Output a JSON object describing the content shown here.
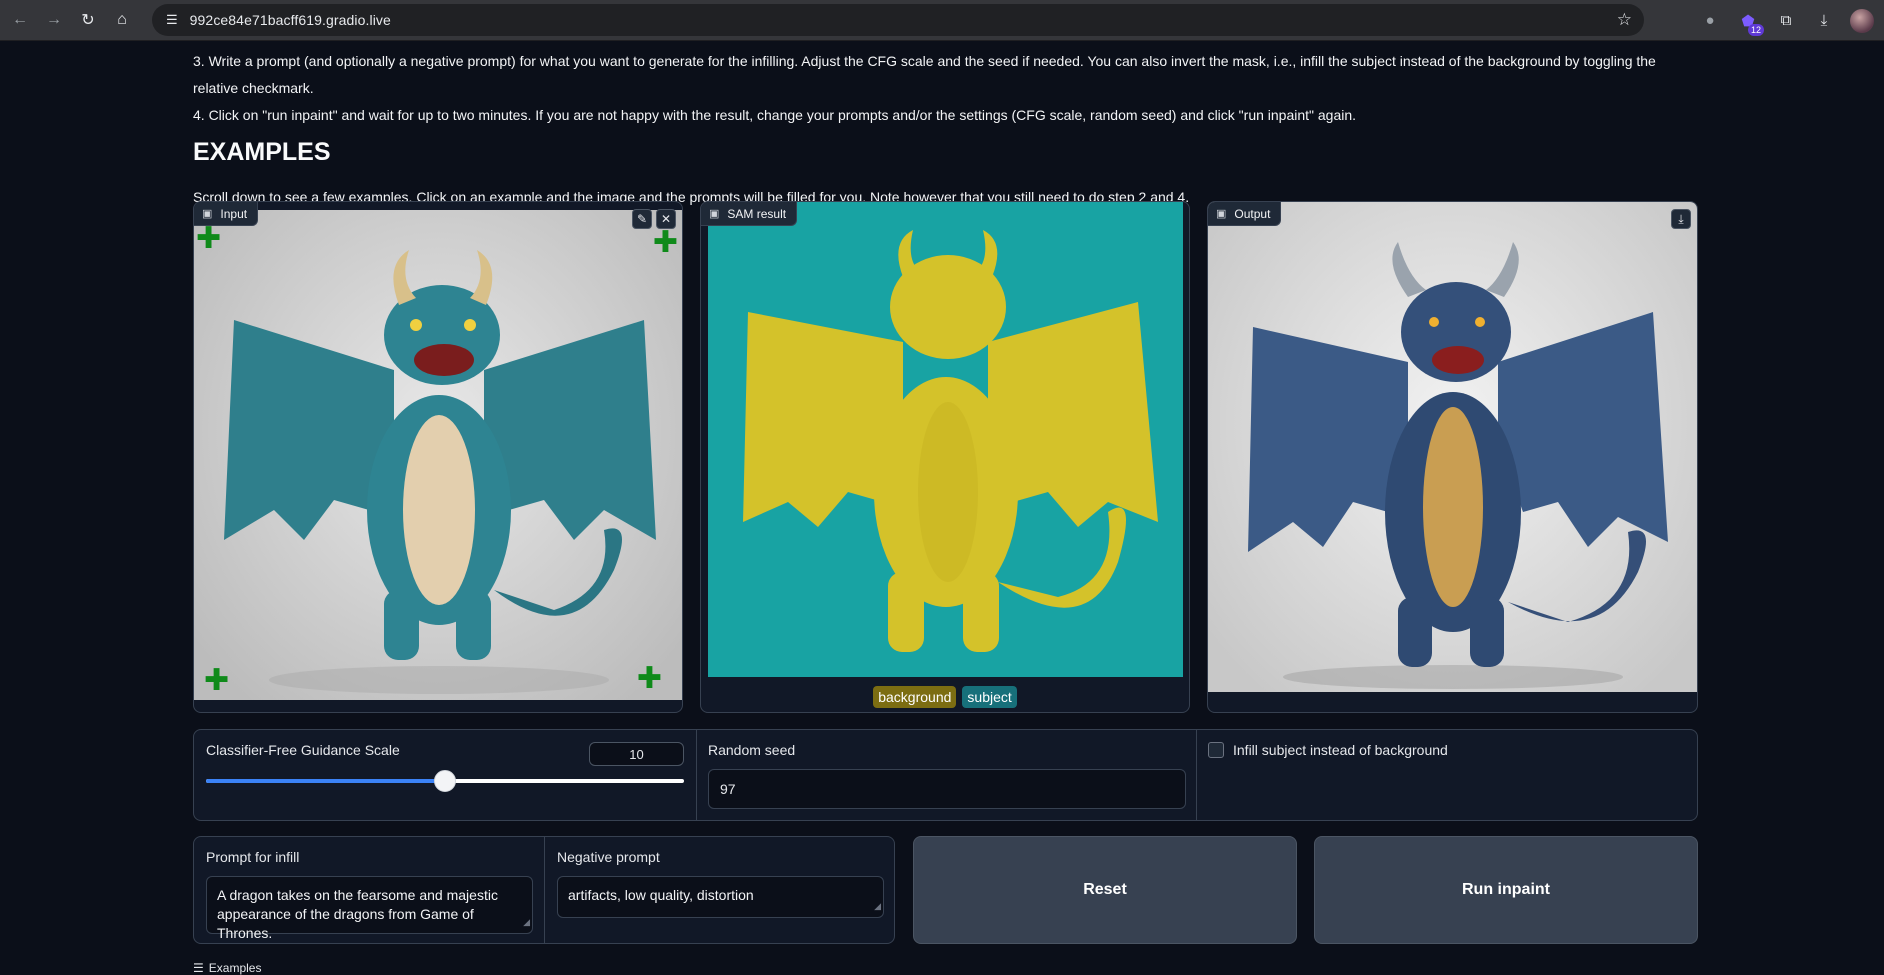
{
  "browser": {
    "url": "992ce84e71bacff619.gradio.live",
    "extensions_badge": "12"
  },
  "instructions": {
    "step3": "3. Write a prompt (and optionally a negative prompt) for what you want to generate for the infilling. Adjust the CFG scale and the seed if needed. You can also invert the mask, i.e., infill the subject instead of the background by toggling the relative checkmark.",
    "step4": "4. Click on \"run inpaint\" and wait for up to two minutes. If you are not happy with the result, change your prompts and/or the settings (CFG scale, random seed) and click \"run inpaint\" again."
  },
  "examples_section": {
    "title": "EXAMPLES",
    "lead": "Scroll down to see a few examples. Click on an example and the image and the prompts will be filled for you. Note however that you still need to do step 2 and 4."
  },
  "panels": {
    "input_label": "Input",
    "sam_label": "SAM result",
    "output_label": "Output",
    "legend_background": "background",
    "legend_subject": "subject",
    "plus_glyph": "✚"
  },
  "controls": {
    "cfg_label": "Classifier-Free Guidance Scale",
    "cfg_value": "10",
    "cfg_fraction": 0.5,
    "seed_label": "Random seed",
    "seed_value": "97",
    "infill_label": "Infill subject instead of background",
    "infill_checked": false
  },
  "prompts": {
    "prompt_label": "Prompt for infill",
    "prompt_value": "A dragon takes on the fearsome and majestic appearance of the dragons from Game of Thrones.",
    "negative_label": "Negative prompt",
    "negative_value": "artifacts, low quality, distortion"
  },
  "actions": {
    "reset_label": "Reset",
    "run_label": "Run inpaint"
  },
  "footer": {
    "examples_label": "Examples"
  },
  "colors": {
    "accent": "#3b82f6",
    "mask_background": "#18a3a3",
    "mask_subject": "#d4c22a"
  }
}
